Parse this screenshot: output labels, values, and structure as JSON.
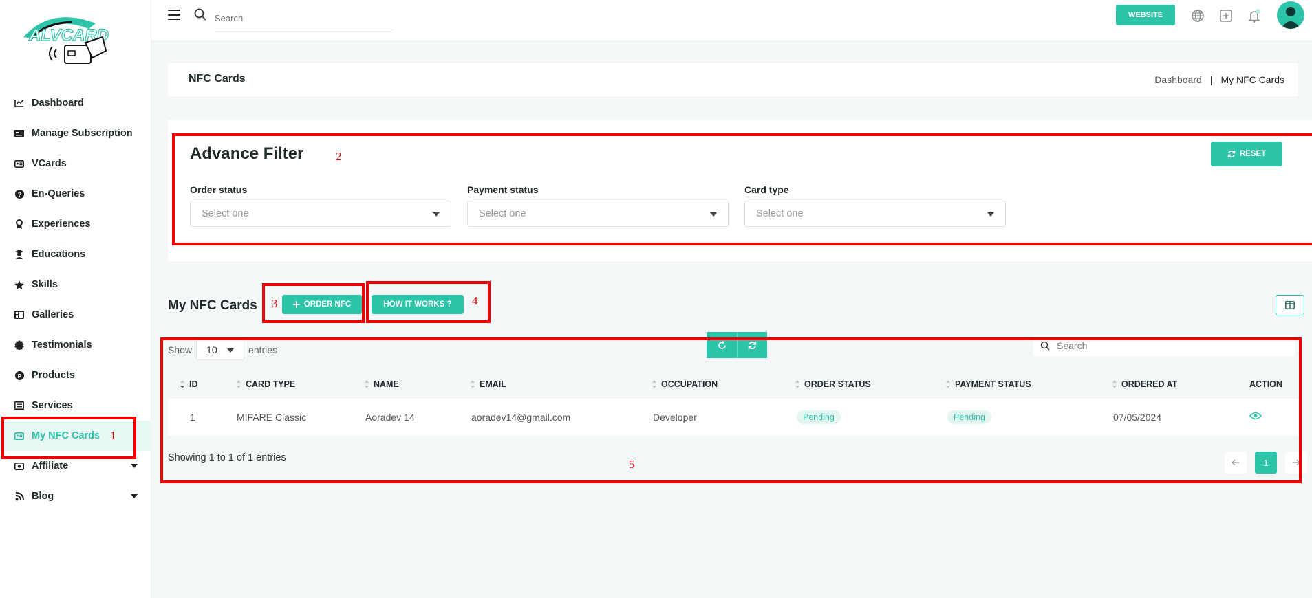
{
  "sidebar": {
    "logo_text": "ALVCARD",
    "items": [
      {
        "label": "Dashboard",
        "icon": "chart-line-icon"
      },
      {
        "label": "Manage Subscription",
        "icon": "card-icon"
      },
      {
        "label": "VCards",
        "icon": "id-card-icon"
      },
      {
        "label": "En-Queries",
        "icon": "question-icon"
      },
      {
        "label": "Experiences",
        "icon": "award-icon"
      },
      {
        "label": "Educations",
        "icon": "graduate-icon"
      },
      {
        "label": "Skills",
        "icon": "star-icon"
      },
      {
        "label": "Galleries",
        "icon": "image-icon"
      },
      {
        "label": "Testimonials",
        "icon": "badge-icon"
      },
      {
        "label": "Products",
        "icon": "product-icon"
      },
      {
        "label": "Services",
        "icon": "list-icon"
      },
      {
        "label": "My NFC Cards",
        "icon": "nfc-card-icon",
        "active": true
      },
      {
        "label": "Affiliate",
        "icon": "money-icon",
        "has_submenu": true
      },
      {
        "label": "Blog",
        "icon": "blog-icon",
        "has_submenu": true
      }
    ]
  },
  "topbar": {
    "search_placeholder": "Search",
    "website_label": "WEBSITE"
  },
  "header": {
    "title": "NFC Cards",
    "breadcrumb": [
      "Dashboard",
      "|",
      "My NFC Cards"
    ]
  },
  "filter": {
    "title": "Advance Filter",
    "reset_label": "RESET",
    "fields": [
      {
        "label": "Order status",
        "value": "Select one"
      },
      {
        "label": "Payment status",
        "value": "Select one"
      },
      {
        "label": "Card type",
        "value": "Select one"
      }
    ]
  },
  "section": {
    "title": "My NFC Cards",
    "order_label": "ORDER NFC",
    "how_label": "HOW IT WORKS ?"
  },
  "table": {
    "show_label": "Show",
    "entries_label": "entries",
    "page_size": "10",
    "search_placeholder": "Search",
    "columns": [
      "ID",
      "CARD TYPE",
      "NAME",
      "EMAIL",
      "OCCUPATION",
      "ORDER STATUS",
      "PAYMENT STATUS",
      "ORDERED AT",
      "ACTION"
    ],
    "rows": [
      {
        "id": "1",
        "card_type": "MIFARE Classic",
        "name": "Aoradev 14",
        "email": "aoradev14@gmail.com",
        "occupation": "Developer",
        "order_status": "Pending",
        "payment_status": "Pending",
        "ordered_at": "07/05/2024"
      }
    ],
    "info": "Showing 1 to 1 of 1 entries",
    "current_page": "1"
  },
  "annotations": [
    "1",
    "2",
    "3",
    "4",
    "5"
  ],
  "colors": {
    "accent": "#2ec4a9",
    "annotation": "#f00000"
  }
}
